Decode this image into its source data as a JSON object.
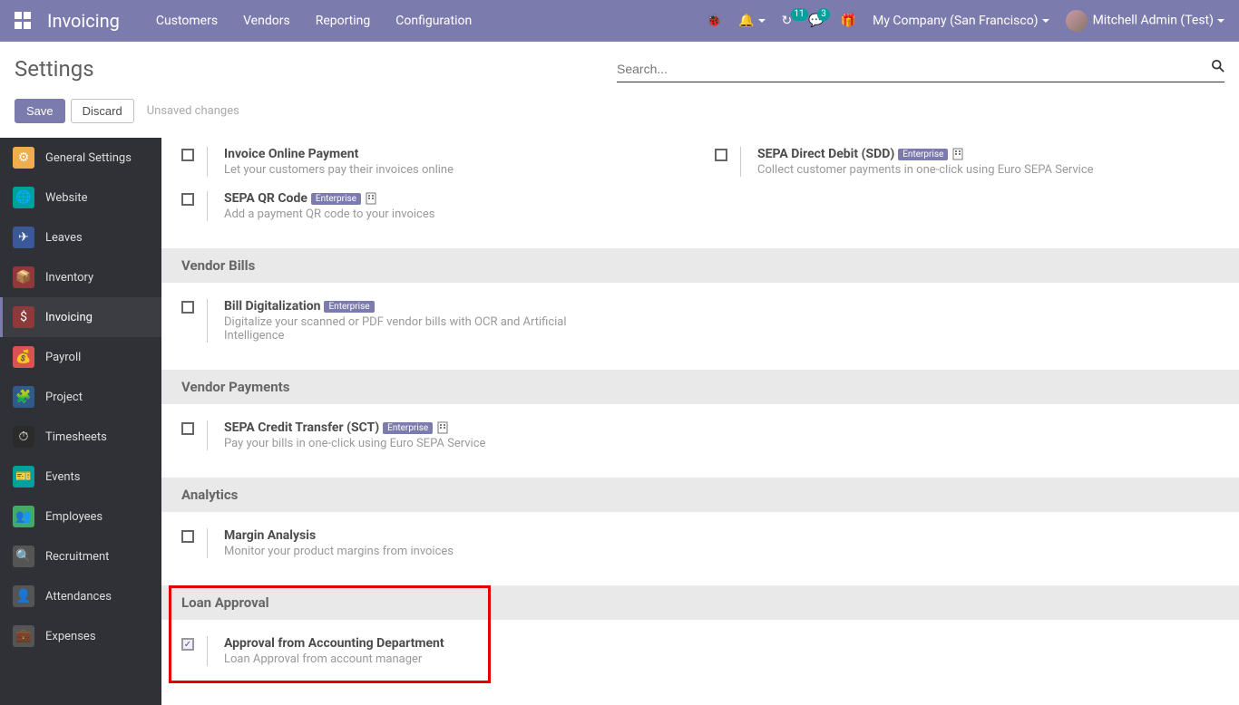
{
  "navbar": {
    "brand": "Invoicing",
    "menu": [
      "Customers",
      "Vendors",
      "Reporting",
      "Configuration"
    ],
    "activity_count": "11",
    "discuss_count": "3",
    "company": "My Company (San Francisco)",
    "user": "Mitchell Admin (Test)"
  },
  "control": {
    "title": "Settings",
    "search_placeholder": "Search...",
    "save": "Save",
    "discard": "Discard",
    "unsaved": "Unsaved changes"
  },
  "sidebar": {
    "items": [
      {
        "label": "General Settings",
        "color": "#f0ad4e",
        "icon": "⚙"
      },
      {
        "label": "Website",
        "color": "#00a09d",
        "icon": "🌐"
      },
      {
        "label": "Leaves",
        "color": "#3b5998",
        "icon": "✈"
      },
      {
        "label": "Inventory",
        "color": "#8f3a3a",
        "icon": "📦"
      },
      {
        "label": "Invoicing",
        "color": "#8f3a3a",
        "icon": "$",
        "active": true
      },
      {
        "label": "Payroll",
        "color": "#d9534f",
        "icon": "💰"
      },
      {
        "label": "Project",
        "color": "#2f5a8a",
        "icon": "🧩"
      },
      {
        "label": "Timesheets",
        "color": "#2b2b2b",
        "icon": "⏱"
      },
      {
        "label": "Events",
        "color": "#00a09d",
        "icon": "🎫"
      },
      {
        "label": "Employees",
        "color": "#4a6",
        "icon": "👥"
      },
      {
        "label": "Recruitment",
        "color": "#555",
        "icon": "🔍"
      },
      {
        "label": "Attendances",
        "color": "#555",
        "icon": "👤"
      },
      {
        "label": "Expenses",
        "color": "#555",
        "icon": "💼"
      }
    ]
  },
  "badges": {
    "enterprise": "Enterprise"
  },
  "sections": {
    "s0": {
      "items": [
        {
          "title": "Invoice Online Payment",
          "desc": "Let your customers pay their invoices online"
        },
        {
          "title": "SEPA Direct Debit (SDD)",
          "desc": "Collect customer payments in one-click using Euro SEPA Service",
          "enterprise": true,
          "grid": true
        },
        {
          "title": "SEPA QR Code",
          "desc": "Add a payment QR code to your invoices",
          "enterprise": true,
          "grid": true
        }
      ]
    },
    "s1": {
      "head": "Vendor Bills",
      "items": [
        {
          "title": "Bill Digitalization",
          "desc": "Digitalize your scanned or PDF vendor bills with OCR and Artificial Intelligence",
          "enterprise": true
        }
      ]
    },
    "s2": {
      "head": "Vendor Payments",
      "items": [
        {
          "title": "SEPA Credit Transfer (SCT)",
          "desc": "Pay your bills in one-click using Euro SEPA Service",
          "enterprise": true,
          "grid": true
        }
      ]
    },
    "s3": {
      "head": "Analytics",
      "items": [
        {
          "title": "Margin Analysis",
          "desc": "Monitor your product margins from invoices"
        }
      ]
    },
    "s4": {
      "head": "Loan Approval",
      "items": [
        {
          "title": "Approval from Accounting Department",
          "desc": "Loan Approval from account manager",
          "checked": true
        }
      ]
    }
  }
}
